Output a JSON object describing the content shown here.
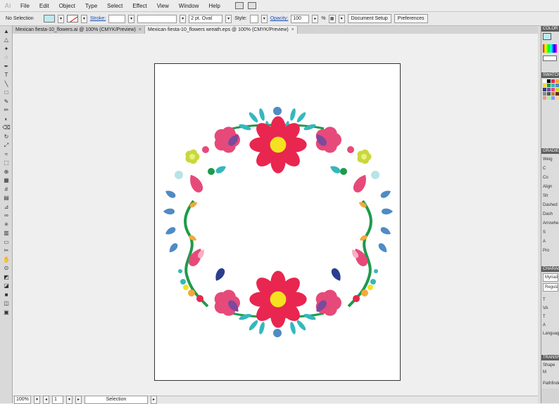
{
  "menubar": {
    "logo": "Ai",
    "items": [
      "File",
      "Edit",
      "Object",
      "Type",
      "Select",
      "Effect",
      "View",
      "Window",
      "Help"
    ]
  },
  "control": {
    "selection": "No Selection",
    "stroke_label": "Stroke:",
    "stroke_value": "",
    "brush": "2 pt. Oval",
    "style_label": "Style:",
    "opacity_label": "Opacity:",
    "opacity_value": "100",
    "opacity_unit": "%",
    "doc_setup": "Document Setup",
    "preferences": "Preferences"
  },
  "tabs": [
    {
      "label": "Mexican fiesta-10_flowers.ai @ 100% (CMYK/Preview)",
      "close": "×"
    },
    {
      "label": "Mexican fiesta-10_flowers wreath.eps @ 100% (CMYK/Preview)",
      "close": "×"
    }
  ],
  "status": {
    "zoom": "100%",
    "page": "1",
    "tool": "Selection"
  },
  "panels": {
    "color": "COLOR",
    "swatches": "SWATCHES",
    "gradient": "GRADIENT",
    "gradient_rows": [
      "Weig",
      "C",
      "Co",
      "Align Str",
      "Dashed",
      "",
      "Dash",
      "Arrowhe",
      "S",
      "A",
      "Pro"
    ],
    "character": "CHARACTER",
    "font": "Myriad P",
    "style": "Regular",
    "language": "Language",
    "transform": "TRANSFORM",
    "shape": "Shape M",
    "pathfinder": "Pathfinde"
  },
  "colors": {
    "pink": "#e64a7a",
    "red": "#e8264f",
    "teal": "#34b8bd",
    "blue": "#4f8bc4",
    "yellow": "#f5e11f",
    "purple": "#7a4a9e",
    "green": "#1e9a4a",
    "orange": "#f4a83c",
    "lime": "#c9d83a",
    "navy": "#2b3d8f"
  },
  "swatch_colors": [
    "#ffffff",
    "#000000",
    "#e8264f",
    "#f4a83c",
    "#f5e11f",
    "#1e9a4a",
    "#34b8bd",
    "#4f8bc4",
    "#2b3d8f",
    "#7a4a9e",
    "#e64a7a",
    "#c9d83a",
    "#888888",
    "#555555",
    "#c08040",
    "#603010",
    "#ff9090",
    "#90ff90",
    "#9090ff",
    "#ffd090"
  ]
}
